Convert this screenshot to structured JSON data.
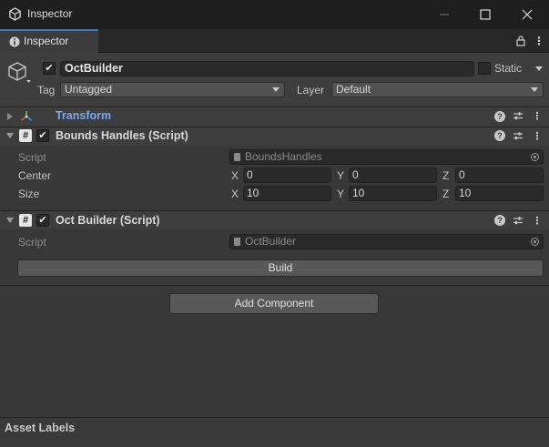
{
  "window": {
    "title": "Inspector"
  },
  "tab": {
    "label": "Inspector"
  },
  "object": {
    "name": "OctBuilder",
    "static_label": "Static",
    "tag_label": "Tag",
    "tag_value": "Untagged",
    "layer_label": "Layer",
    "layer_value": "Default"
  },
  "transform": {
    "title": "Transform"
  },
  "bounds_handles": {
    "title": "Bounds Handles (Script)",
    "script_label": "Script",
    "script_value": "BoundsHandles",
    "center_label": "Center",
    "size_label": "Size",
    "center": {
      "x_label": "X",
      "x": "0",
      "y_label": "Y",
      "y": "0",
      "z_label": "Z",
      "z": "0"
    },
    "size": {
      "x_label": "X",
      "x": "10",
      "y_label": "Y",
      "y": "10",
      "z_label": "Z",
      "z": "10"
    }
  },
  "oct_builder": {
    "title": "Oct Builder (Script)",
    "script_label": "Script",
    "script_value": "OctBuilder",
    "build_button": "Build"
  },
  "add_component_button": "Add Component",
  "footer": {
    "label": "Asset Labels"
  },
  "colors": {
    "accent": "#3a79bb",
    "transform_title": "#7fa7e6",
    "background": "#383838"
  }
}
